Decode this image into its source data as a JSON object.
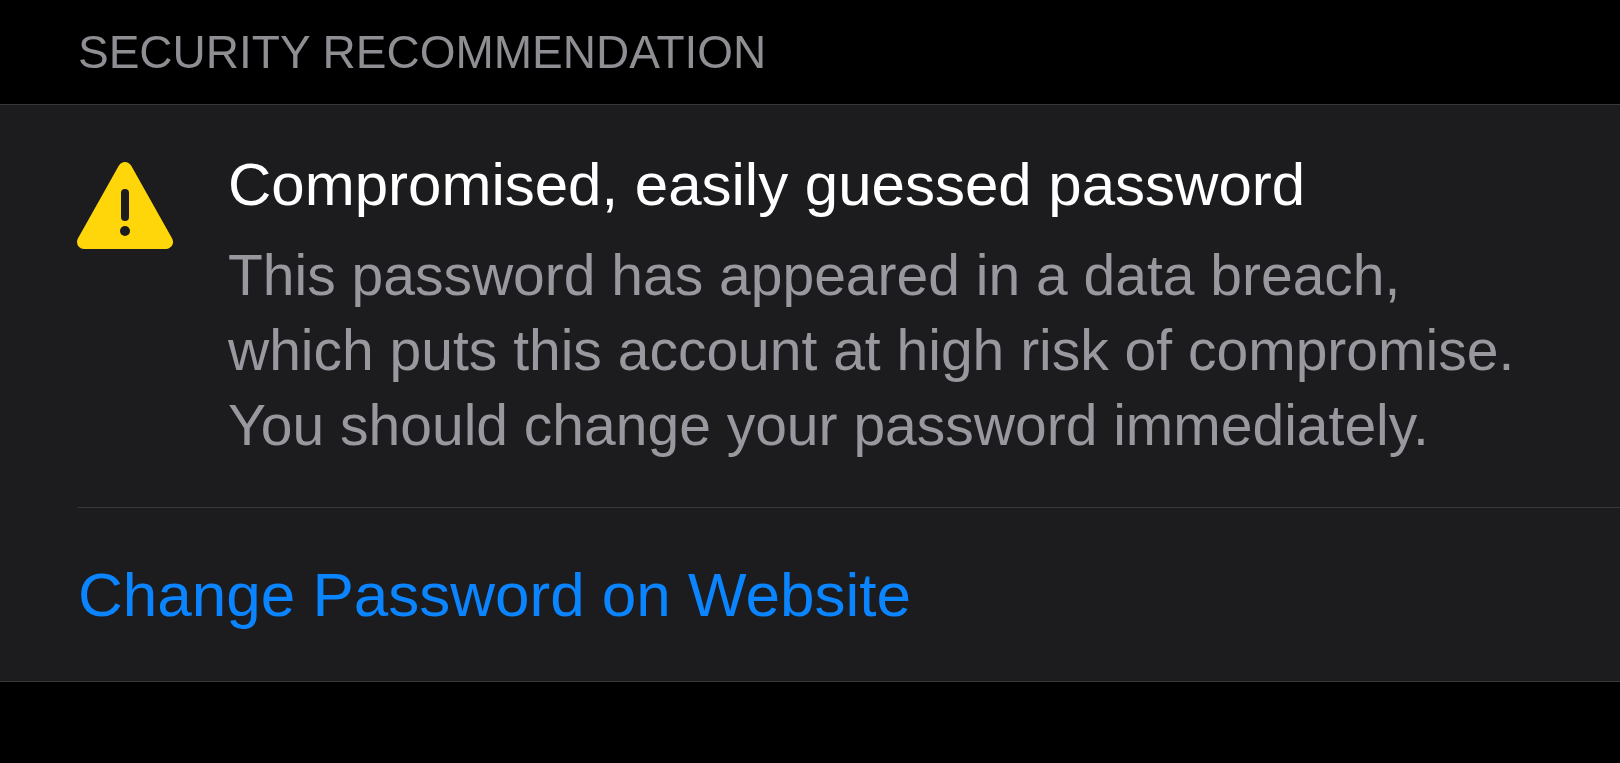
{
  "section_header": "SECURITY RECOMMENDATION",
  "recommendation": {
    "title": "Compromised, easily guessed password",
    "description": "This password has appeared in a data breach, which puts this account at high risk of compromise. You should change your password immediately."
  },
  "action": {
    "label": "Change Password on Website"
  }
}
